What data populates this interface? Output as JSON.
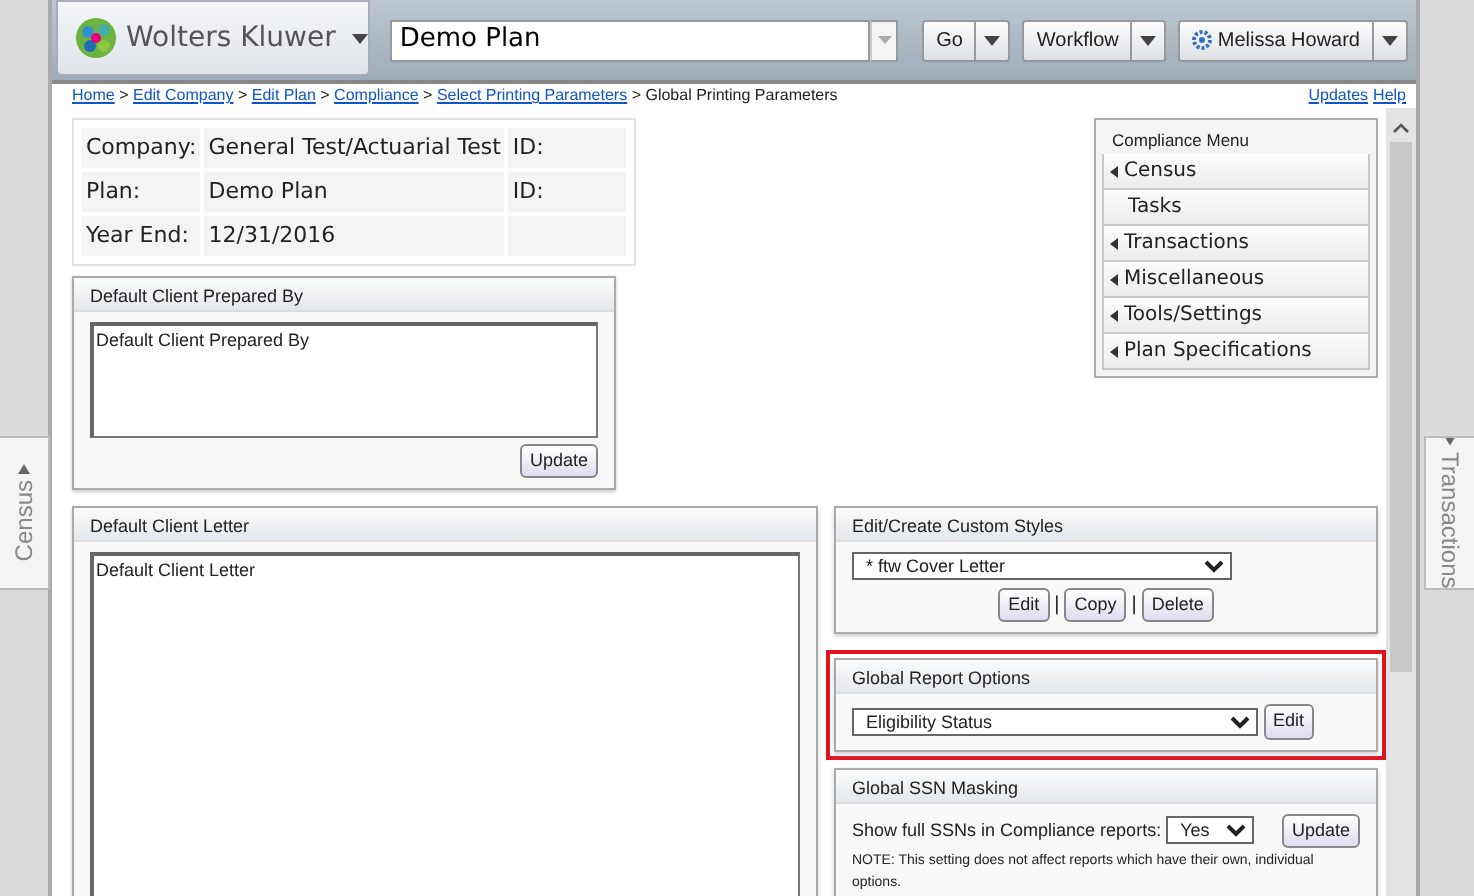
{
  "header": {
    "logo_text": "Wolters Kluwer",
    "search_value": "Demo Plan",
    "go_label": "Go",
    "workflow_label": "Workflow",
    "user_name": "Melissa Howard"
  },
  "breadcrumb": [
    {
      "label": "Home",
      "link": true
    },
    {
      "label": "Edit Company",
      "link": true
    },
    {
      "label": "Edit Plan",
      "link": true
    },
    {
      "label": "Compliance",
      "link": true
    },
    {
      "label": "Select Printing Parameters",
      "link": true
    },
    {
      "label": "Global Printing Parameters",
      "link": false
    }
  ],
  "breadcrumb_separators": [
    ">",
    ">",
    ">",
    ">",
    ">"
  ],
  "top_links": [
    "Updates",
    "Help"
  ],
  "info_rows": [
    {
      "label": "Company:",
      "value": "General Test/Actuarial Test",
      "id_label": "ID:"
    },
    {
      "label": "Plan:",
      "value": "Demo Plan",
      "id_label": "ID:"
    },
    {
      "label": "Year End:",
      "value": "12/31/2016"
    }
  ],
  "prepared_panel": {
    "title": "Default Client Prepared By",
    "text": "Default Client Prepared By",
    "button": "Update"
  },
  "letter_panel": {
    "title": "Default Client Letter",
    "text": "Default Client Letter"
  },
  "compliance_menu": {
    "title": "Compliance Menu",
    "items": [
      {
        "label": "Census",
        "has_submenu": true
      },
      {
        "label": "Tasks",
        "has_submenu": false
      },
      {
        "label": "Transactions",
        "has_submenu": true
      },
      {
        "label": "Miscellaneous",
        "has_submenu": true
      },
      {
        "label": "Tools/Settings",
        "has_submenu": true
      },
      {
        "label": "Plan Specifications",
        "has_submenu": true
      }
    ]
  },
  "styles_panel": {
    "title": "Edit/Create Custom Styles",
    "selected_style": "* ftw Cover Letter",
    "buttons": [
      "Edit",
      "Copy",
      "Delete"
    ],
    "separators": [
      "|",
      "|"
    ]
  },
  "report_panel": {
    "title": "Global Report Options",
    "highlighted": true,
    "selected_option": "Eligibility Status",
    "button": "Edit"
  },
  "ssn_panel": {
    "title": "Global SSN Masking",
    "label": "Show full SSNs in Compliance reports:",
    "selected_value": "Yes",
    "button": "Update",
    "note": "NOTE: This setting does not affect reports which have their own, individual options."
  },
  "side_tabs": {
    "left": "Census",
    "right": "Transactions"
  }
}
